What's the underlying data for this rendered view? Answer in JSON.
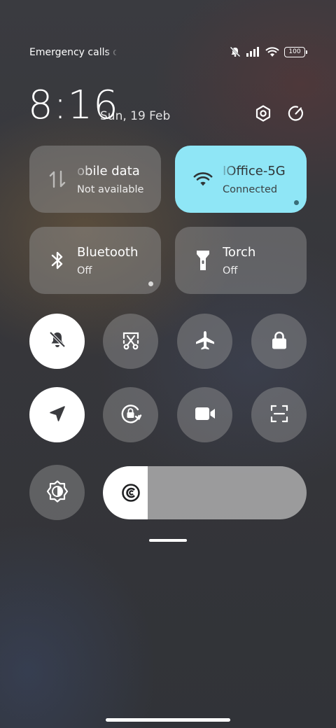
{
  "status_bar": {
    "text": "Emergency calls o",
    "battery": "100",
    "icons": [
      "mute-icon",
      "signal-icon",
      "wifi-icon",
      "battery-icon"
    ]
  },
  "header": {
    "time": "8:16",
    "date": "Sun, 19 Feb",
    "icons": [
      "settings-icon",
      "edit-icon"
    ]
  },
  "tiles": [
    {
      "title": "obile data",
      "subtitle": "Not available",
      "icon": "mobile-data-icon",
      "active": false
    },
    {
      "title": "IOffice-5G",
      "subtitle": "Connected",
      "icon": "wifi-icon",
      "active": true
    },
    {
      "title": "Bluetooth",
      "subtitle": "Off",
      "icon": "bluetooth-icon",
      "active": false
    },
    {
      "title": "Torch",
      "subtitle": "Off",
      "icon": "torch-icon",
      "active": false
    }
  ],
  "toggles": [
    {
      "icon": "silent-bell-icon",
      "on": true
    },
    {
      "icon": "screenshot-icon",
      "on": false
    },
    {
      "icon": "airplane-icon",
      "on": false
    },
    {
      "icon": "lock-icon",
      "on": false
    },
    {
      "icon": "location-icon",
      "on": true
    },
    {
      "icon": "rotation-lock-icon",
      "on": false
    },
    {
      "icon": "screen-record-icon",
      "on": false
    },
    {
      "icon": "scanner-icon",
      "on": false
    },
    {
      "icon": "auto-brightness-icon",
      "on": false
    }
  ],
  "brightness": {
    "level": 0.22,
    "icon": "brightness-icon"
  },
  "colors": {
    "active_tile": "#8fe6f6",
    "tile": "#6b6b6e",
    "toggle_on": "#ffffff"
  }
}
